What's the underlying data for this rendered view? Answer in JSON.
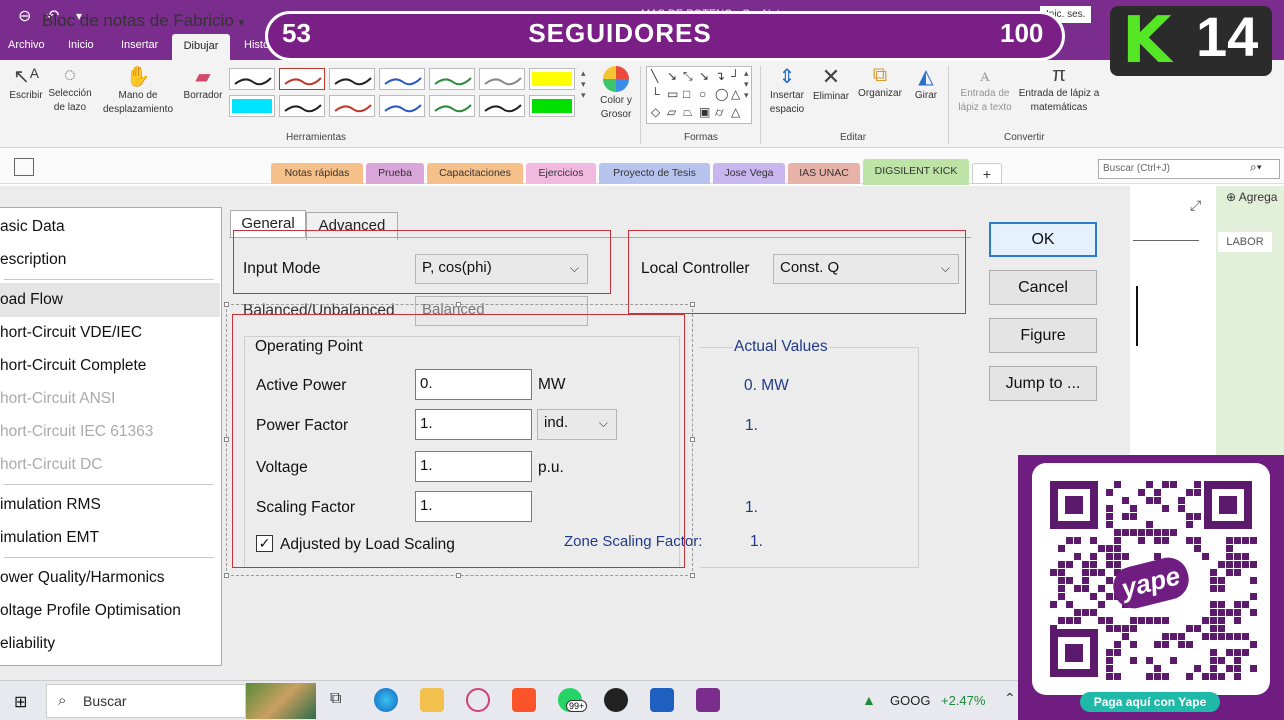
{
  "titlebar": {
    "window_title": "…MAS DE POTENC - OneNote",
    "sign_in": "Inic. ses."
  },
  "ribbon_tabs": [
    "Archivo",
    "Inicio",
    "Insertar",
    "Dibujar",
    "Histo"
  ],
  "ribbon": {
    "tools": [
      {
        "label": "Escribir",
        "icon": "pen-cursor-icon"
      },
      {
        "label": "Selección de lazo",
        "icon": "lasso-icon"
      },
      {
        "label": "Mano de desplazamiento",
        "icon": "hand-icon"
      },
      {
        "label": "Borrador",
        "icon": "eraser-icon"
      }
    ],
    "group_tools": "Herramientas",
    "color_thickness": "Color y Grosor",
    "group_shapes": "Formas",
    "edit_tools": [
      {
        "label": "Insertar espacio",
        "icon": "insert-space-icon"
      },
      {
        "label": "Eliminar",
        "icon": "delete-icon"
      },
      {
        "label": "Organizar",
        "icon": "arrange-icon"
      },
      {
        "label": "Girar",
        "icon": "rotate-icon"
      }
    ],
    "group_edit": "Editar",
    "convert_tools": [
      {
        "label": "Entrada de lápiz a texto",
        "icon": "ink-to-text-icon"
      },
      {
        "label": "Entrada de lápiz a matemáticas",
        "icon": "ink-to-math-icon"
      }
    ],
    "group_convert": "Convertir",
    "pen_colors": [
      "#222222",
      "#c0392b",
      "#222222",
      "#2b59c3",
      "#2e8b3a",
      "#888888",
      "#ffff00",
      "#00e5ff",
      "#222222",
      "#c0392b",
      "#2b59c3",
      "#2e8b3a",
      "#222222",
      "#00e000",
      "#ff00ff"
    ]
  },
  "notebook": {
    "title": "Bloc de notas de Fabricio",
    "sections": [
      {
        "label": "Notas rápidas",
        "color": "#f6c08a"
      },
      {
        "label": "Prueba",
        "color": "#d8a6d8"
      },
      {
        "label": "Capacitaciones",
        "color": "#f6c08a"
      },
      {
        "label": "Ejercicios",
        "color": "#f1b8e0"
      },
      {
        "label": "Proyecto de Tesis",
        "color": "#b7c4ee"
      },
      {
        "label": "Jose Vega",
        "color": "#c9b6ee"
      },
      {
        "label": "IAS UNAC",
        "color": "#e7b3a8"
      },
      {
        "label": "DIGSILENT KICK",
        "color": "#bde3a6"
      }
    ],
    "add_section": "+",
    "search_placeholder": "Buscar (Ctrl+J)",
    "add_page": "Agrega",
    "page_label": "LABOR"
  },
  "left_nav": [
    {
      "label": "asic Data",
      "disabled": false
    },
    {
      "label": "escription",
      "disabled": false
    },
    {
      "label": "oad Flow",
      "disabled": false,
      "selected": true
    },
    {
      "label": "hort-Circuit VDE/IEC",
      "disabled": false
    },
    {
      "label": "hort-Circuit Complete",
      "disabled": false
    },
    {
      "label": "hort-Circuit ANSI",
      "disabled": true
    },
    {
      "label": "hort-Circuit IEC 61363",
      "disabled": true
    },
    {
      "label": "hort-Circuit DC",
      "disabled": true
    },
    {
      "label": "imulation RMS",
      "disabled": false
    },
    {
      "label": "imulation EMT",
      "disabled": false
    },
    {
      "label": "ower Quality/Harmonics",
      "disabled": false
    },
    {
      "label": "oltage Profile Optimisation",
      "disabled": false
    },
    {
      "label": "eliability",
      "disabled": false
    }
  ],
  "dialog": {
    "tabs": [
      "General",
      "Advanced"
    ],
    "input_mode_label": "Input Mode",
    "input_mode_value": "P, cos(phi)",
    "balanced_label": "Balanced/Unbalanced",
    "balanced_value": "Balanced",
    "local_controller_label": "Local Controller",
    "local_controller_value": "Const. Q",
    "operating_point_title": "Operating Point",
    "actual_values_title": "Actual Values",
    "rows": [
      {
        "label": "Active Power",
        "value": "0.",
        "unit": "MW",
        "actual": "0. MW"
      },
      {
        "label": "Power Factor",
        "value": "1.",
        "unit_select": "ind.",
        "actual": "1."
      },
      {
        "label": "Voltage",
        "value": "1.",
        "unit": "p.u.",
        "actual": ""
      },
      {
        "label": "Scaling Factor",
        "value": "1.",
        "unit": "",
        "actual": "1."
      }
    ],
    "adjusted_label": "Adjusted by Load Scaling",
    "adjusted_checked": true,
    "zone_scaling_label": "Zone Scaling Factor:",
    "zone_scaling_value": "1.",
    "buttons": [
      "OK",
      "Cancel",
      "Figure",
      "Jump to ..."
    ]
  },
  "taskbar": {
    "search": "Buscar",
    "ticker": "GOOG",
    "ticker_change": "+2.47%",
    "badge": "99+"
  },
  "overlay": {
    "left_number": "53",
    "title": "SEGUIDORES",
    "right_number": "100",
    "brand_letter": "K",
    "brand_number": "14"
  },
  "yape": {
    "logo": "yape",
    "button": "Paga aquí con Yape"
  }
}
